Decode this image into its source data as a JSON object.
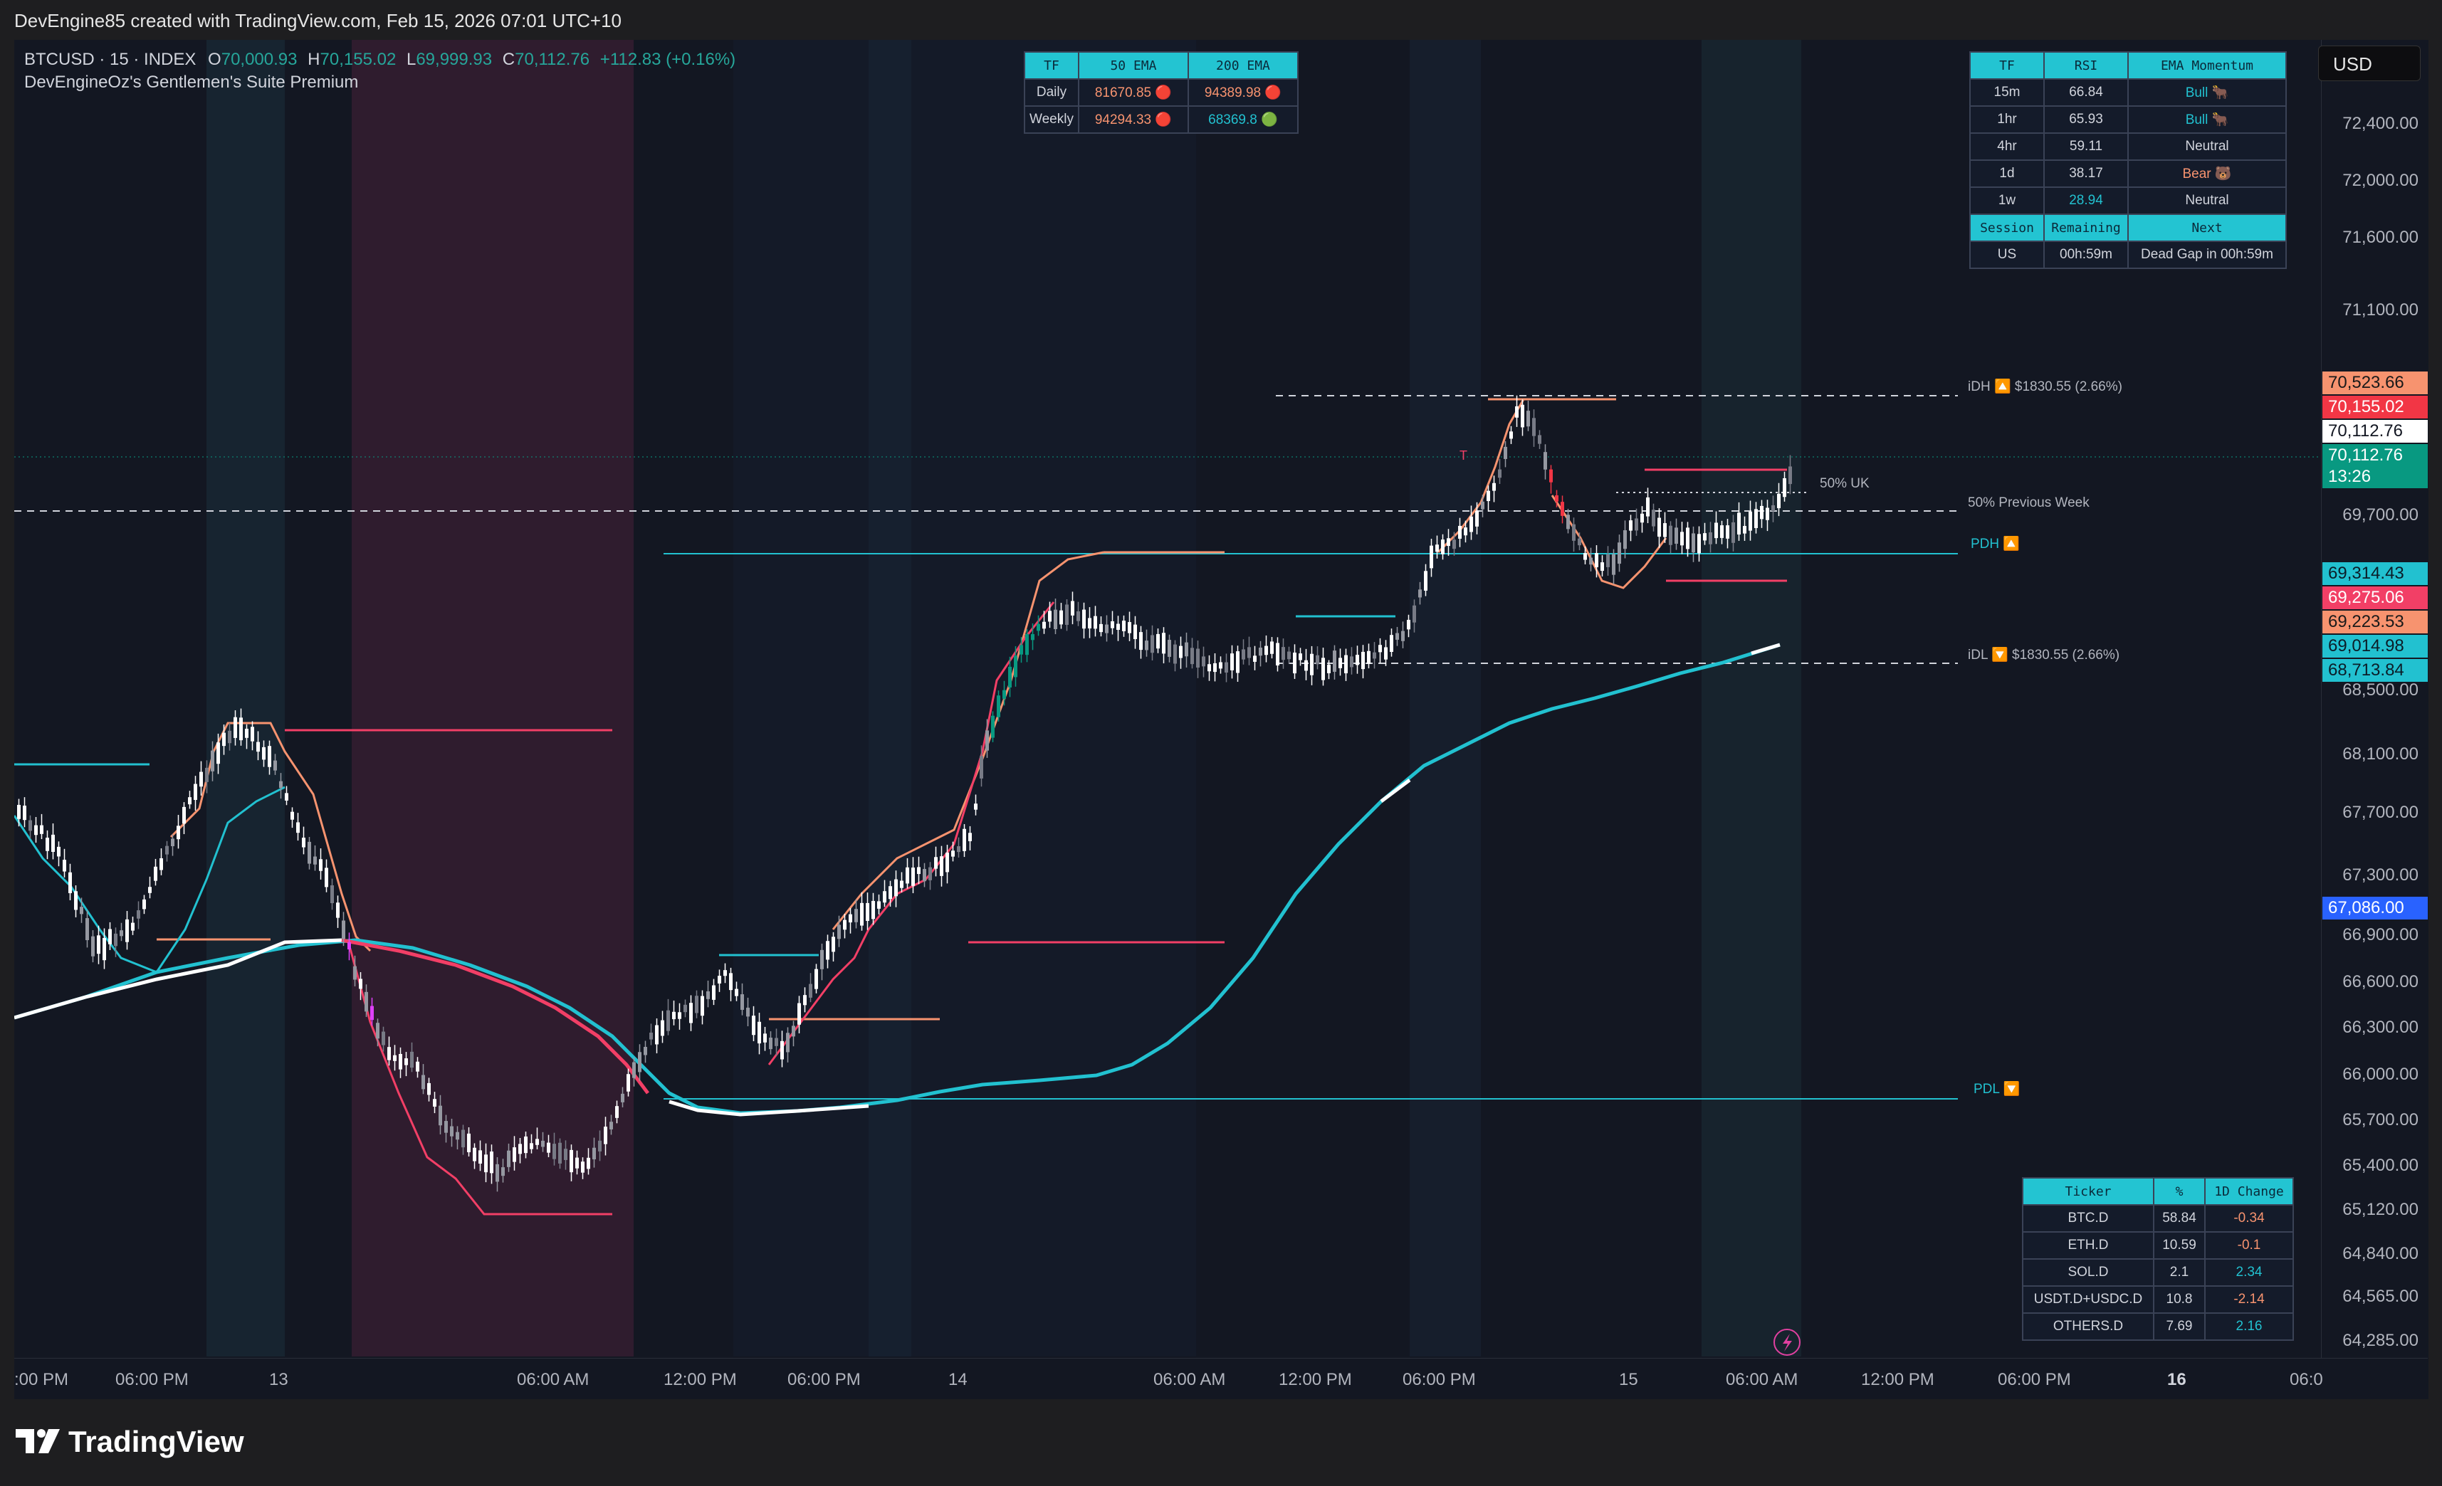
{
  "header": {
    "text": "DevEngine85 created with TradingView.com, Feb 15, 2026 07:01 UTC+10"
  },
  "legend": {
    "symbol": "BTCUSD · 15 · INDEX",
    "o_label": "O",
    "o": "70,000.93",
    "h_label": "H",
    "h": "70,155.02",
    "l_label": "L",
    "l": "69,999.93",
    "c_label": "C",
    "c": "70,112.76",
    "change": "+112.83 (+0.16%)",
    "indicator": "DevEngineOz's Gentlemen's Suite Premium"
  },
  "ema_table": {
    "headers": [
      "TF",
      "50 EMA",
      "200 EMA"
    ],
    "rows": [
      {
        "tf": "Daily",
        "ema50": "81670.85",
        "ema50_dot": "🔴",
        "ema200": "94389.98",
        "ema200_dot": "🔴"
      },
      {
        "tf": "Weekly",
        "ema50": "94294.33",
        "ema50_dot": "🔴",
        "ema200": "68369.8",
        "ema200_dot": "🟢"
      }
    ]
  },
  "rsi_table": {
    "headers": [
      "TF",
      "RSI",
      "EMA Momentum"
    ],
    "rows": [
      {
        "tf": "15m",
        "rsi": "66.84",
        "mom": "Bull 🐂"
      },
      {
        "tf": "1hr",
        "rsi": "65.93",
        "mom": "Bull 🐂"
      },
      {
        "tf": "4hr",
        "rsi": "59.11",
        "mom": "Neutral"
      },
      {
        "tf": "1d",
        "rsi": "38.17",
        "mom": "Bear 🐻"
      },
      {
        "tf": "1w",
        "rsi": "28.94",
        "mom": "Neutral"
      }
    ],
    "session_headers": [
      "Session",
      "Remaining",
      "Next"
    ],
    "session": {
      "name": "US",
      "remaining": "00h:59m",
      "next": "Dead Gap in 00h:59m"
    }
  },
  "dominance_table": {
    "headers": [
      "Ticker",
      "%",
      "1D Change"
    ],
    "rows": [
      {
        "ticker": "BTC.D",
        "pct": "58.84",
        "chg": "-0.34"
      },
      {
        "ticker": "ETH.D",
        "pct": "10.59",
        "chg": "-0.1"
      },
      {
        "ticker": "SOL.D",
        "pct": "2.1",
        "chg": "2.34"
      },
      {
        "ticker": "USDT.D+USDC.D",
        "pct": "10.8",
        "chg": "-2.14"
      },
      {
        "ticker": "OTHERS.D",
        "pct": "7.69",
        "chg": "2.16"
      }
    ]
  },
  "annotations": {
    "idh": "iDH 🔼 $1830.55 (2.66%)",
    "idl": "iDL 🔽 $1830.55 (2.66%)",
    "pdh": "PDH 🔼",
    "pdl": "PDL 🔽",
    "uk50": "50% UK",
    "prev_week": "50% Previous Week",
    "t_marker": "T"
  },
  "price_scale": {
    "currency": "USD",
    "labels": [
      "72,400.00",
      "72,000.00",
      "71,600.00",
      "71,100.00",
      "69,700.00",
      "68,500.00",
      "68,100.00",
      "67,700.00",
      "67,300.00",
      "66,900.00",
      "66,600.00",
      "66,300.00",
      "66,000.00",
      "65,700.00",
      "65,400.00",
      "65,120.00",
      "64,840.00",
      "64,565.00",
      "64,285.00"
    ],
    "badges": [
      {
        "text": "70,523.66",
        "bg": "#f7936f",
        "fg": "#1a1a1a"
      },
      {
        "text": "70,155.02",
        "bg": "#f23645",
        "fg": "#ffffff"
      },
      {
        "text": "70,112.76",
        "bg": "#ffffff",
        "fg": "#131722"
      },
      {
        "text": "70,112.76",
        "bg": "#089981",
        "fg": "#ffffff"
      },
      {
        "text": "13:26",
        "bg": "#089981",
        "fg": "#ffffff"
      },
      {
        "text": "69,314.43",
        "bg": "#22c1d0",
        "fg": "#0b1d28"
      },
      {
        "text": "69,275.06",
        "bg": "#f23f66",
        "fg": "#ffffff"
      },
      {
        "text": "69,223.53",
        "bg": "#f7936f",
        "fg": "#1a1a1a"
      },
      {
        "text": "69,014.98",
        "bg": "#22c1d0",
        "fg": "#0b1d28"
      },
      {
        "text": "68,713.84",
        "bg": "#22c1d0",
        "fg": "#0b1d28"
      },
      {
        "text": "67,086.00",
        "bg": "#2962ff",
        "fg": "#ffffff"
      }
    ]
  },
  "time_axis": {
    "labels": [
      ":00 PM",
      "06:00 PM",
      "13",
      "06:00 AM",
      "12:00 PM",
      "06:00 PM",
      "14",
      "06:00 AM",
      "12:00 PM",
      "06:00 PM",
      "15",
      "06:00 AM",
      "12:00 PM",
      "06:00 PM",
      "16",
      "06:0"
    ]
  },
  "footer": {
    "brand": "TradingView"
  },
  "colors": {
    "background": "#131722",
    "cyan": "#22c1d0",
    "salmon": "#f7936f",
    "pink": "#f23f66",
    "green_candle": "#089981",
    "red_candle": "#f23645",
    "white_ema": "#ffffff"
  }
}
